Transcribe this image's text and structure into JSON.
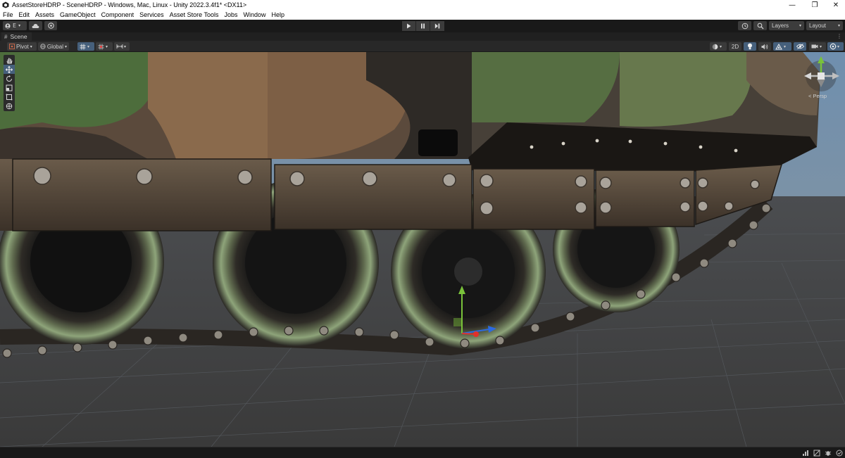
{
  "window": {
    "title": "AssetStoreHDRP - SceneHDRP - Windows, Mac, Linux - Unity 2022.3.4f1* <DX11>",
    "icon": "unity-logo-icon",
    "controls": {
      "minimize": "—",
      "maximize": "❐",
      "close": "✕"
    }
  },
  "menubar": {
    "items": [
      "File",
      "Edit",
      "Assets",
      "GameObject",
      "Component",
      "Services",
      "Asset Store Tools",
      "Jobs",
      "Window",
      "Help"
    ]
  },
  "toolbar": {
    "account_label": "E",
    "account_icon": "account-icon",
    "cloud_icon": "cloud-icon",
    "collab_icon": "collab-icon",
    "play_icon": "play-icon",
    "pause_icon": "pause-icon",
    "step_icon": "step-icon",
    "history_icon": "undo-history-icon",
    "search_icon": "search-icon",
    "layers_label": "Layers",
    "layout_label": "Layout"
  },
  "scene_tab": {
    "label": "Scene",
    "icon": "scene-hash-icon",
    "menu_icon": "kebab-menu-icon"
  },
  "scene_toolbar": {
    "pivot_label": "Pivot",
    "global_label": "Global",
    "twod_label": "2D",
    "icons": [
      "grid-snap-icon",
      "increment-snap-icon",
      "draw-mode-icon",
      "lighting-icon",
      "audio-icon",
      "effects-icon",
      "hidden-objects-icon",
      "camera-icon",
      "gizmos-icon"
    ]
  },
  "tools": [
    "hand-tool-icon",
    "move-tool-icon",
    "rotate-tool-icon",
    "scale-tool-icon",
    "rect-tool-icon",
    "transform-tool-icon"
  ],
  "gizmo": {
    "projection_label": "< Persp"
  },
  "statusbar": {
    "icons": [
      "progress-icon",
      "lighting-status-icon",
      "debug-icon",
      "notification-icon"
    ]
  },
  "colors": {
    "editor_bg": "#191919",
    "panel_bg": "#282828",
    "active_tool": "#46607c",
    "axis_x": "#e0312b",
    "axis_y": "#79c23a",
    "axis_z": "#2c6ae0"
  }
}
